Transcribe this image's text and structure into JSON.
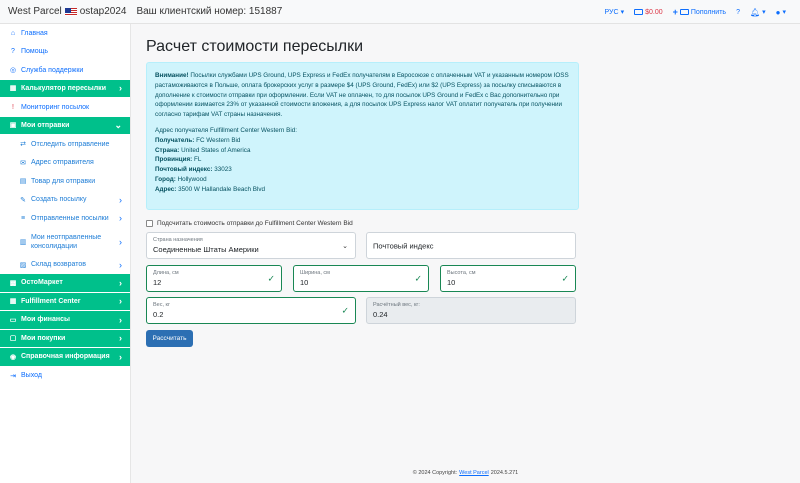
{
  "topbar": {
    "brand": "West Parcel",
    "username": "ostap2024",
    "client_label": "Ваш клиентский номер: 151887",
    "lang": "РУС",
    "balance": "$0.00",
    "topup": "Пополнить",
    "help": "?"
  },
  "sidebar": {
    "home": "Главная",
    "help": "Помощь",
    "support": "Служба поддержки",
    "calculator": "Калькулятор пересылки",
    "monitoring": "Мониторинг посылок",
    "my_shipments": "Мои отправки",
    "track": "Отследить отправление",
    "sender_address": "Адрес отправителя",
    "goods": "Товар для отправки",
    "create_parcel": "Создать посылку",
    "sent_parcels": "Отправленные посылки",
    "unsent_consolidations": "Мои неотправленные консолидации",
    "returns": "Склад возвратов",
    "ostomarket": "ОстоМаркет",
    "fulfillment": "Fulfillment Center",
    "finances": "Мои финансы",
    "purchases": "Мои покупки",
    "reference": "Справочная информация",
    "logout": "Выход"
  },
  "main": {
    "title": "Расчет стоимости пересылки",
    "alert_strong": "Внимание!",
    "alert_text": " Посылки службами UPS Ground, UPS Express и FedEx получателям в Евросоюзе с оплаченным VAT и указанным номером IOSS растаможиваются в Польше, оплата брокерских услуг в размере $4 (UPS Ground, FedEx) или $2 (UPS Express) за посылку списываются в дополнение к стоимости отправки при оформлении. Если VAT не оплачен, то для посылок UPS Ground и FedEx с Вас дополнительно при оформлении взимается 23% от указанной стоимости вложения, а для посылок UPS Express налог VAT оплатит получатель при получении согласно тарифам VAT страны назначения.",
    "addr_heading": "Адрес получателя Fulfillment Center Western Bid:",
    "addr_recipient_label": "Получатель:",
    "addr_recipient": "FC Western Bid",
    "addr_country_label": "Страна:",
    "addr_country": "United States of America",
    "addr_province_label": "Провинция:",
    "addr_province": "FL",
    "addr_zip_label": "Почтовый индекс:",
    "addr_zip": "33023",
    "addr_city_label": "Город:",
    "addr_city": "Hollywood",
    "addr_address_label": "Адрес:",
    "addr_address": "3500 W Hallandale Beach Blvd",
    "checkbox_label": "Подсчитать стоимость отправки до Fulfillment Center Western Bid",
    "country_label": "Страна назначения",
    "country_value": "Соединенные Штаты Америки",
    "zip_placeholder": "Почтовый индекс",
    "length_label": "Длина, см",
    "length_value": "12",
    "width_label": "Ширина, см",
    "width_value": "10",
    "height_label": "Высота, см",
    "height_value": "10",
    "weight_label": "Вес, кг",
    "weight_value": "0.2",
    "calc_weight_label": "Расчётный вес, кг:",
    "calc_weight_value": "0.24",
    "calc_button": "Рассчитать"
  },
  "footer": {
    "copyright": "© 2024 Copyright:",
    "link": "West Parcel",
    "version": "2024.5.271"
  },
  "colors": {
    "accent": "#00c08b",
    "link": "#0d6efd",
    "alert_bg": "#cff4fc",
    "valid": "#198754",
    "button": "#2c6fb3"
  }
}
